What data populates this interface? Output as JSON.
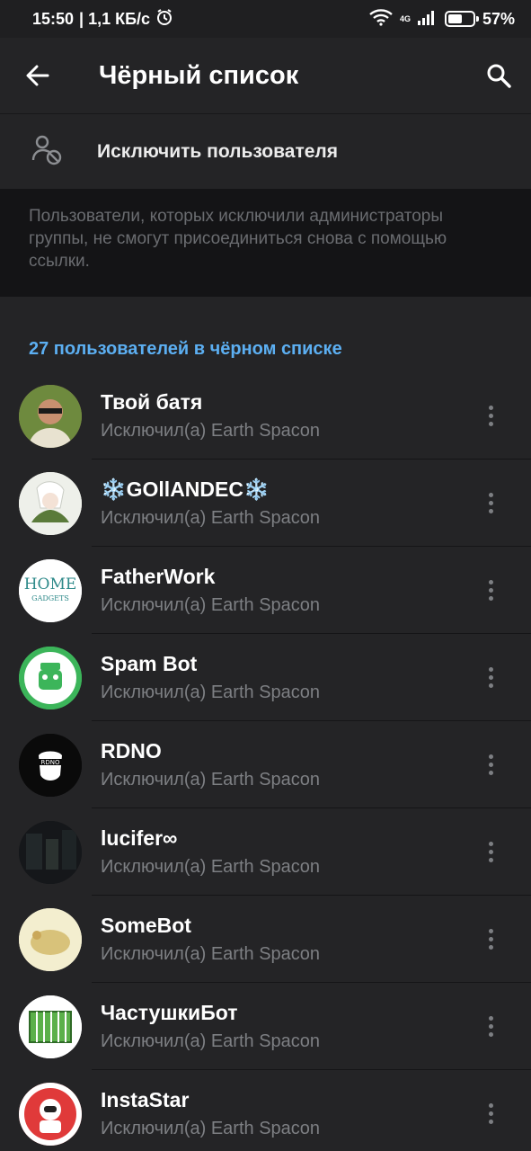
{
  "status": {
    "time": "15:50",
    "speed": "| 1,1 КБ/с",
    "network": "4G",
    "battery_percent": "57%",
    "battery_level": 0.57
  },
  "header": {
    "title": "Чёрный список",
    "back_icon": "back-arrow-icon",
    "search_icon": "search-icon"
  },
  "action": {
    "remove_label": "Исключить пользователя",
    "icon": "remove-user-icon"
  },
  "info": {
    "text": "Пользователи, которых исключили администраторы группы, не смогут присоединиться снова с помощью ссылки."
  },
  "list": {
    "header": "27 пользователей в чёрном списке",
    "users": [
      {
        "name": "Твой батя",
        "sub": "Исключил(а) Earth Spacon",
        "avatar": "photo-person-icon",
        "avatar_color": "#8a6a4a"
      },
      {
        "name": "❄️GOllANDEC❄️",
        "sub": "Исключил(а) Earth Spacon",
        "avatar": "anime-character-icon",
        "avatar_color": "#e8ece4"
      },
      {
        "name": "FatherWork",
        "sub": "Исключил(а) Earth Spacon",
        "avatar": "home-gadgets-logo-icon",
        "avatar_color": "#ffffff"
      },
      {
        "name": "Spam Bot",
        "sub": "Исключил(а) Earth Spacon",
        "avatar": "green-bot-icon",
        "avatar_color": "#3cb55a"
      },
      {
        "name": "RDNO",
        "sub": "Исключил(а) Earth Spacon",
        "avatar": "mask-logo-icon",
        "avatar_color": "#0a0a0a"
      },
      {
        "name": "lucifer∞",
        "sub": "Исключил(а) Earth Spacon",
        "avatar": "dark-photo-icon",
        "avatar_color": "#15171a"
      },
      {
        "name": "SomeBot",
        "sub": "Исключил(а) Earth Spacon",
        "avatar": "chicken-icon",
        "avatar_color": "#f3eecf"
      },
      {
        "name": "ЧастушкиБот",
        "sub": "Исключил(а) Earth Spacon",
        "avatar": "accordion-icon",
        "avatar_color": "#ffffff"
      },
      {
        "name": "InstaStar",
        "sub": "Исключил(а) Earth Spacon",
        "avatar": "astronaut-icon",
        "avatar_color": "#e03a3a"
      }
    ]
  }
}
